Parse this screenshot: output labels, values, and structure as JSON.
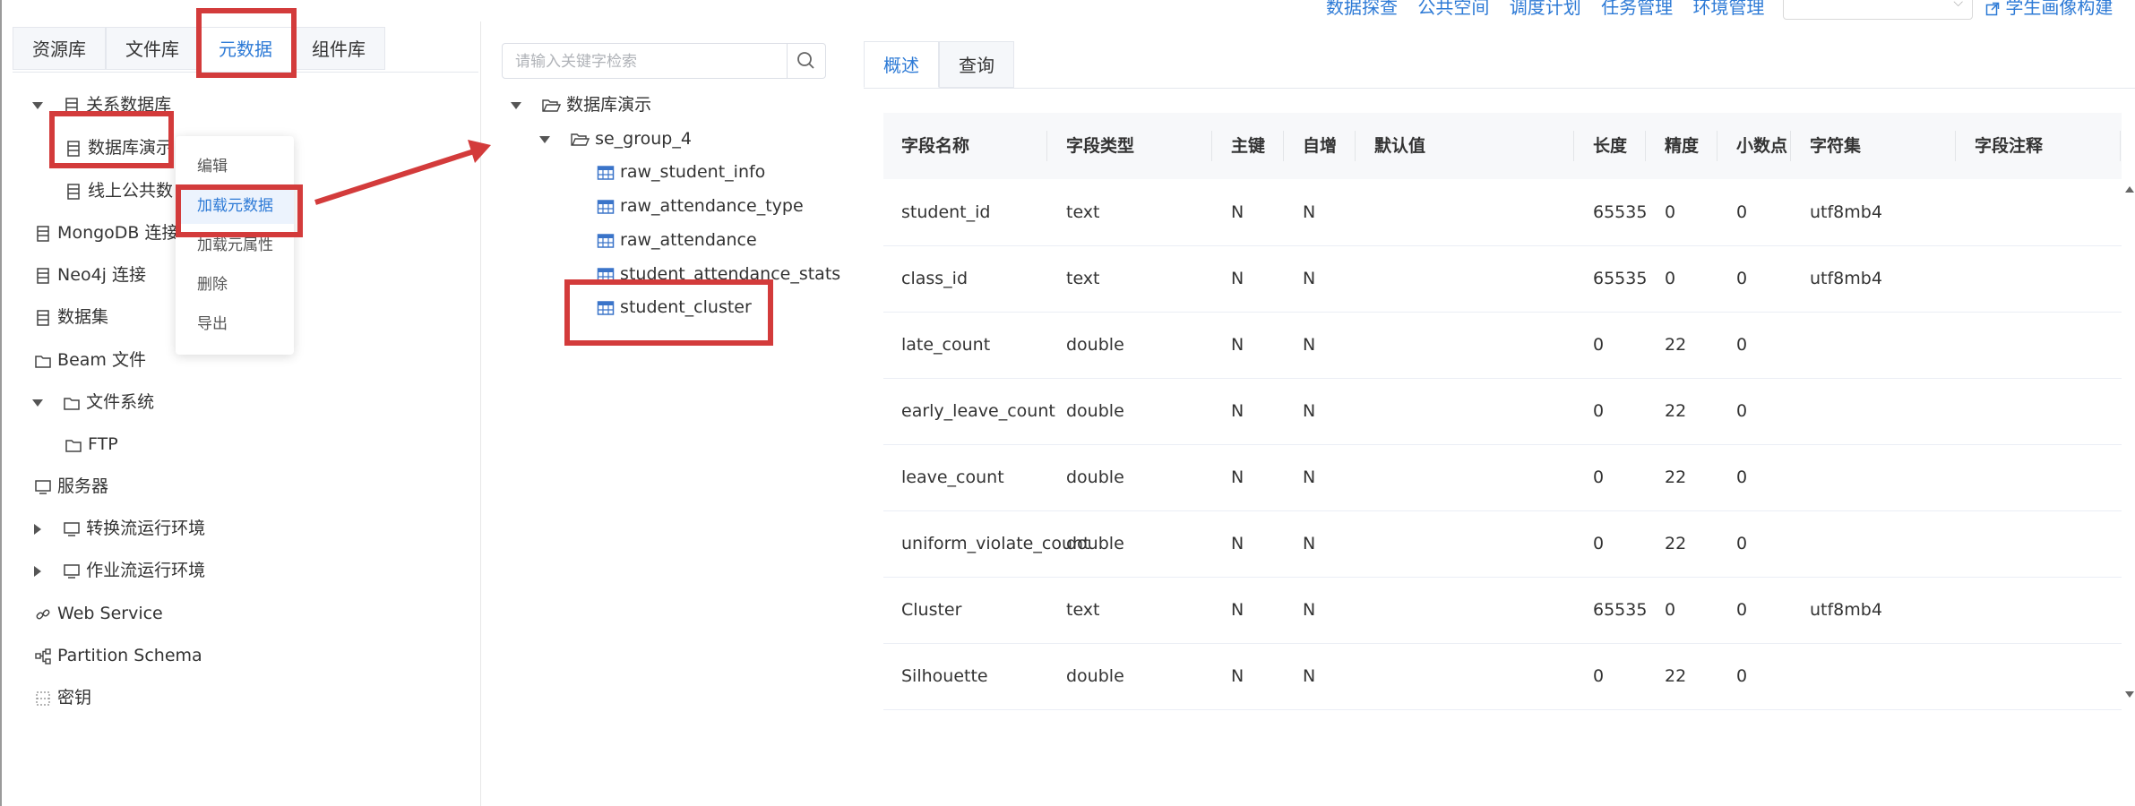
{
  "top_nav": {
    "items": [
      "数据探查",
      "公共空间",
      "调度计划",
      "任务管理",
      "环境管理"
    ],
    "project_select": "",
    "right_link": "学生画像构建"
  },
  "left": {
    "tabs": [
      "资源库",
      "文件库",
      "元数据",
      "组件库"
    ],
    "active_tab": "元数据",
    "tree": {
      "relational_db": "关系数据库",
      "db_demo": "数据库演示",
      "online_public": "线上公共数",
      "mongodb": "MongoDB 连接",
      "neo4j": "Neo4j 连接",
      "dataset": "数据集",
      "beam": "Beam 文件",
      "filesystem": "文件系统",
      "ftp": "FTP",
      "server": "服务器",
      "transform_env": "转换流运行环境",
      "job_env": "作业流运行环境",
      "web_service": "Web Service",
      "partition_schema": "Partition Schema",
      "secret": "密钥"
    },
    "context_menu": [
      "编辑",
      "加载元数据",
      "加载元属性",
      "删除",
      "导出"
    ],
    "context_menu_highlighted": "加载元数据"
  },
  "middle": {
    "search_placeholder": "请输入关键字检索",
    "tree": {
      "root": "数据库演示",
      "group": "se_group_4",
      "tables": [
        "raw_student_info",
        "raw_attendance_type",
        "raw_attendance",
        "student_attendance_stats",
        "student_cluster"
      ]
    }
  },
  "right": {
    "tabs": [
      "概述",
      "查询"
    ],
    "active_tab": "概述",
    "columns": [
      "字段名称",
      "字段类型",
      "主键",
      "自增",
      "默认值",
      "长度",
      "精度",
      "小数点",
      "字符集",
      "字段注释"
    ],
    "rows": [
      [
        "student_id",
        "text",
        "N",
        "N",
        "",
        "65535",
        "0",
        "0",
        "utf8mb4",
        ""
      ],
      [
        "class_id",
        "text",
        "N",
        "N",
        "",
        "65535",
        "0",
        "0",
        "utf8mb4",
        ""
      ],
      [
        "late_count",
        "double",
        "N",
        "N",
        "",
        "0",
        "22",
        "0",
        "",
        ""
      ],
      [
        "early_leave_count",
        "double",
        "N",
        "N",
        "",
        "0",
        "22",
        "0",
        "",
        ""
      ],
      [
        "leave_count",
        "double",
        "N",
        "N",
        "",
        "0",
        "22",
        "0",
        "",
        ""
      ],
      [
        "uniform_violate_count",
        "double",
        "N",
        "N",
        "",
        "0",
        "22",
        "0",
        "",
        ""
      ],
      [
        "Cluster",
        "text",
        "N",
        "N",
        "",
        "65535",
        "0",
        "0",
        "utf8mb4",
        ""
      ],
      [
        "Silhouette",
        "double",
        "N",
        "N",
        "",
        "0",
        "22",
        "0",
        "",
        ""
      ]
    ]
  },
  "colors": {
    "accent": "#2d7ad6",
    "annotation_red": "#d33b3b",
    "table_icon": "#3a74c9"
  }
}
